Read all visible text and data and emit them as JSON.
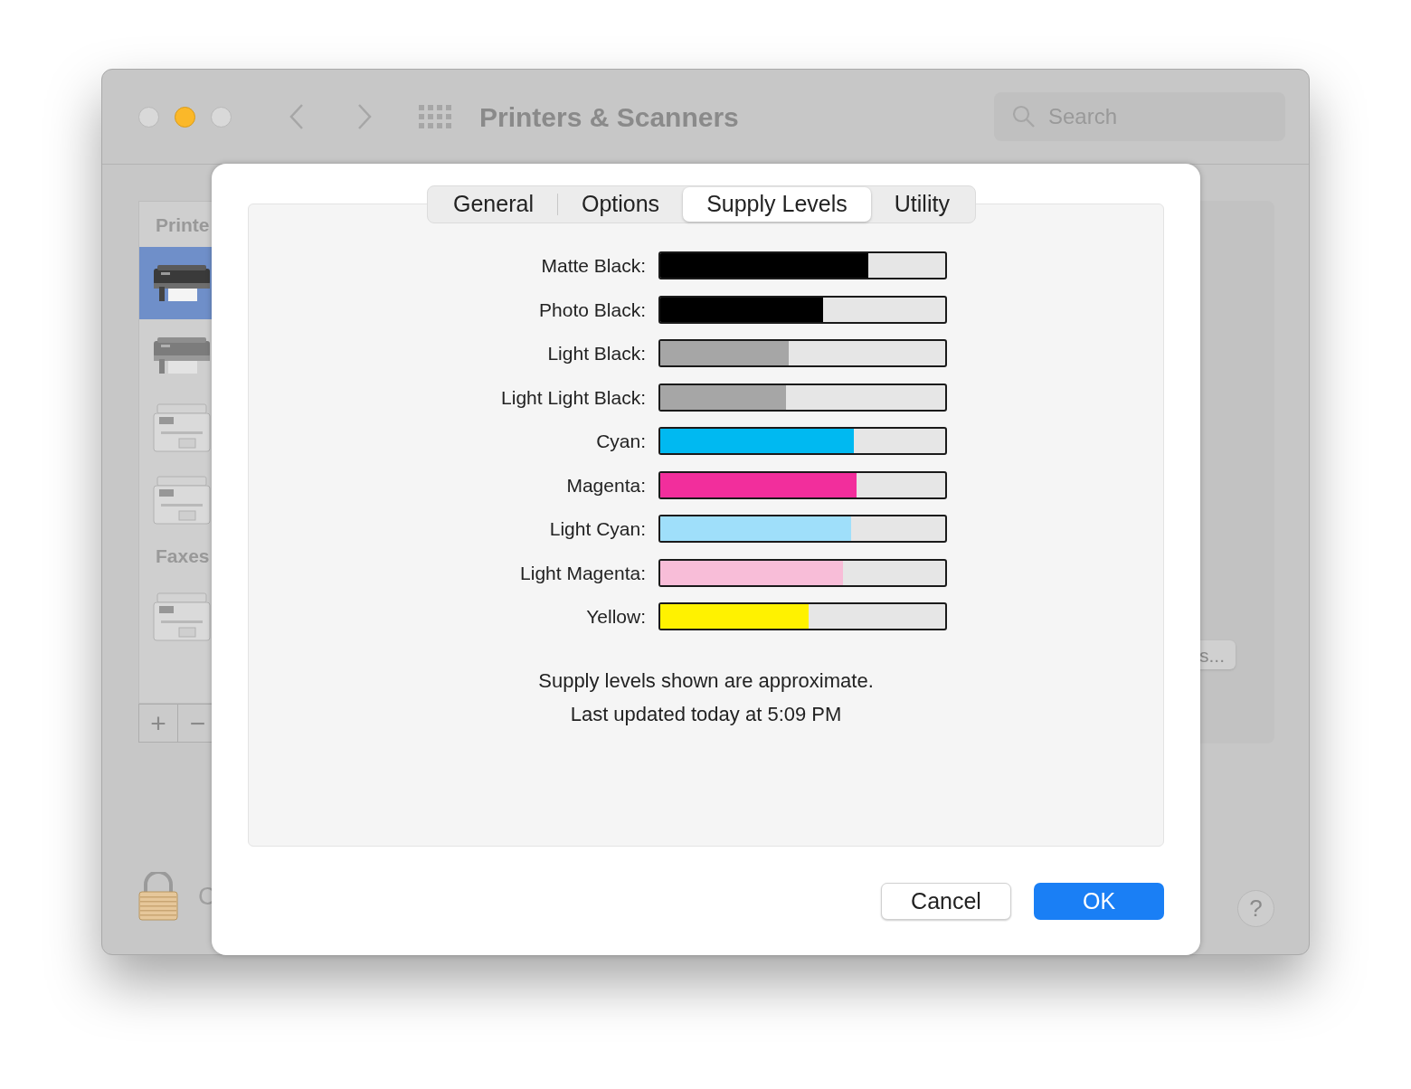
{
  "window": {
    "title": "Printers & Scanners",
    "search": {
      "placeholder": "Search"
    }
  },
  "sidebar": {
    "sections": [
      {
        "title": "Printe",
        "items": [
          {
            "selected": true
          },
          {
            "selected": false
          },
          {
            "selected": false
          },
          {
            "selected": false
          }
        ]
      },
      {
        "title": "Faxes",
        "items": [
          {
            "selected": false
          }
        ]
      }
    ],
    "add_button": "+",
    "remove_button": "−"
  },
  "lock": {
    "label": "C"
  },
  "detail": {
    "button": "s..."
  },
  "help_button": "?",
  "sheet": {
    "tabs": [
      {
        "label": "General",
        "selected": false
      },
      {
        "label": "Options",
        "selected": false
      },
      {
        "label": "Supply Levels",
        "selected": true
      },
      {
        "label": "Utility",
        "selected": false
      }
    ],
    "supplies": [
      {
        "name": "Matte Black:",
        "color": "#000000",
        "level": 0.73
      },
      {
        "name": "Photo Black:",
        "color": "#000000",
        "level": 0.57
      },
      {
        "name": "Light Black:",
        "color": "#a6a6a6",
        "level": 0.45
      },
      {
        "name": "Light Light Black:",
        "color": "#a6a6a6",
        "level": 0.44
      },
      {
        "name": "Cyan:",
        "color": "#00b9f1",
        "level": 0.68
      },
      {
        "name": "Magenta:",
        "color": "#f22e9c",
        "level": 0.69
      },
      {
        "name": "Light Cyan:",
        "color": "#9fdffa",
        "level": 0.67
      },
      {
        "name": "Light Magenta:",
        "color": "#f8bdd8",
        "level": 0.64
      },
      {
        "name": "Yellow:",
        "color": "#fff200",
        "level": 0.52
      }
    ],
    "notes": [
      "Supply levels shown are approximate.",
      "Last updated today at 5:09 PM"
    ],
    "buttons": [
      {
        "label": "Cancel",
        "kind": "secondary"
      },
      {
        "label": "OK",
        "kind": "primary"
      }
    ]
  }
}
